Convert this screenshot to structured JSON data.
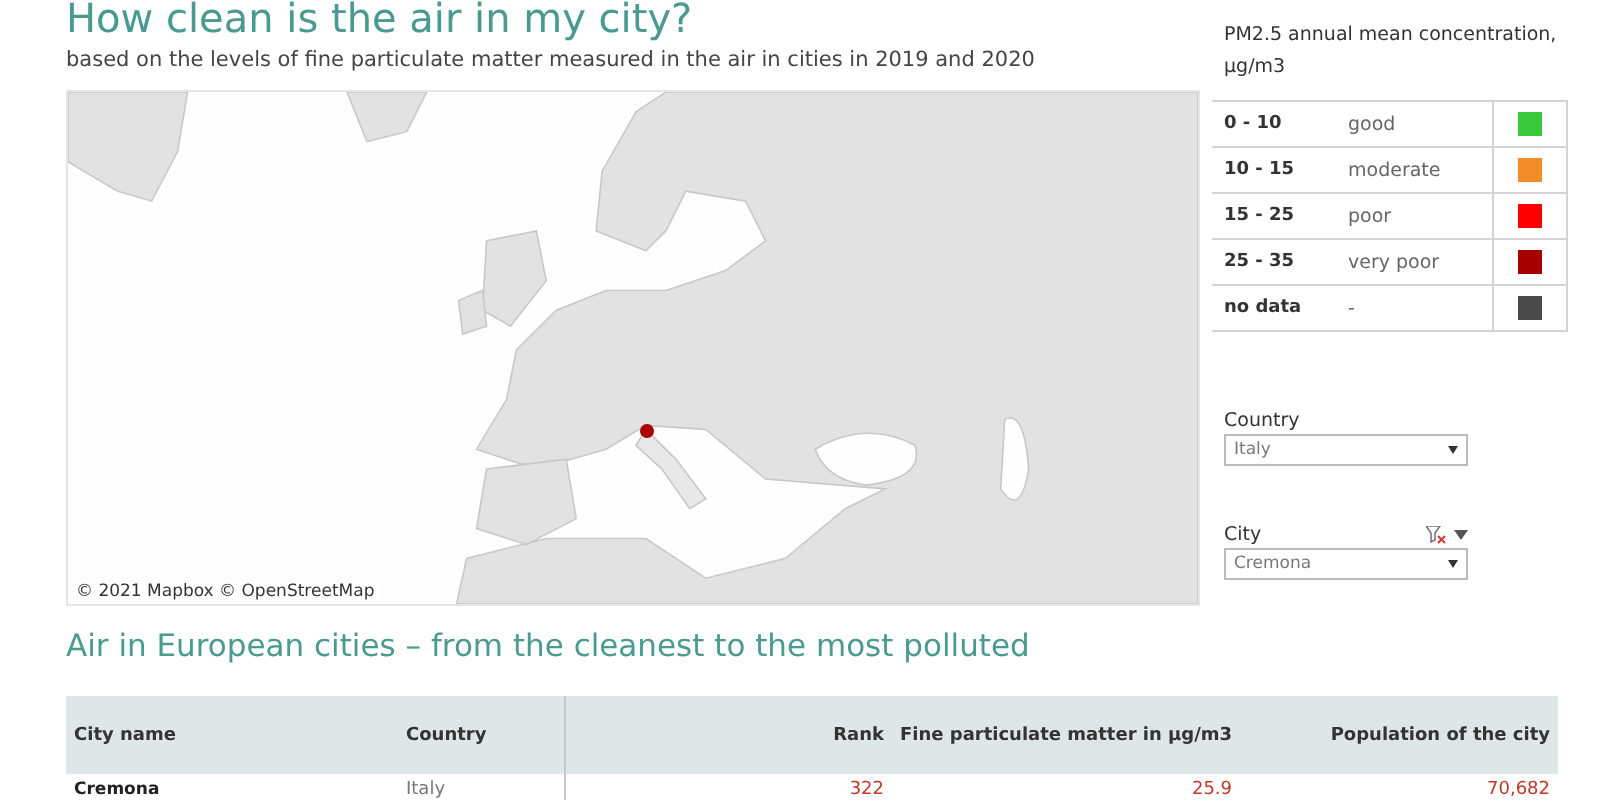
{
  "title": "How clean is the air in my city?",
  "subtitle": "based on the levels of fine particulate matter measured in the air in cities in 2019 and 2020",
  "map": {
    "kind": "picture",
    "attribution": "© 2021 Mapbox © OpenStreetMap"
  },
  "legend": {
    "title": "PM2.5 annual mean concentration, µg/m3",
    "rows": [
      {
        "range": "0 - 10",
        "label": "good",
        "color": "#3cc83c"
      },
      {
        "range": "10 - 15",
        "label": "moderate",
        "color": "#f28c28"
      },
      {
        "range": "15 - 25",
        "label": "poor",
        "color": "#ff0000"
      },
      {
        "range": "25 - 35",
        "label": "very poor",
        "color": "#a80000"
      },
      {
        "range": "no data",
        "label": "-",
        "color": "#4a4a4a"
      }
    ]
  },
  "filters": [
    {
      "label": "Country",
      "value": "Italy",
      "filtered": false
    },
    {
      "label": "City",
      "value": "Cremona",
      "filtered": true
    }
  ],
  "table": {
    "heading": "Air in European cities – from the cleanest to the most polluted",
    "columns": [
      "City name",
      "Country",
      "Rank",
      "Fine particulate matter in µg/m3",
      "Population of the city"
    ],
    "rows": [
      {
        "cells": [
          "Cremona",
          "Italy",
          "322",
          "25.9",
          "70,682"
        ]
      }
    ]
  }
}
